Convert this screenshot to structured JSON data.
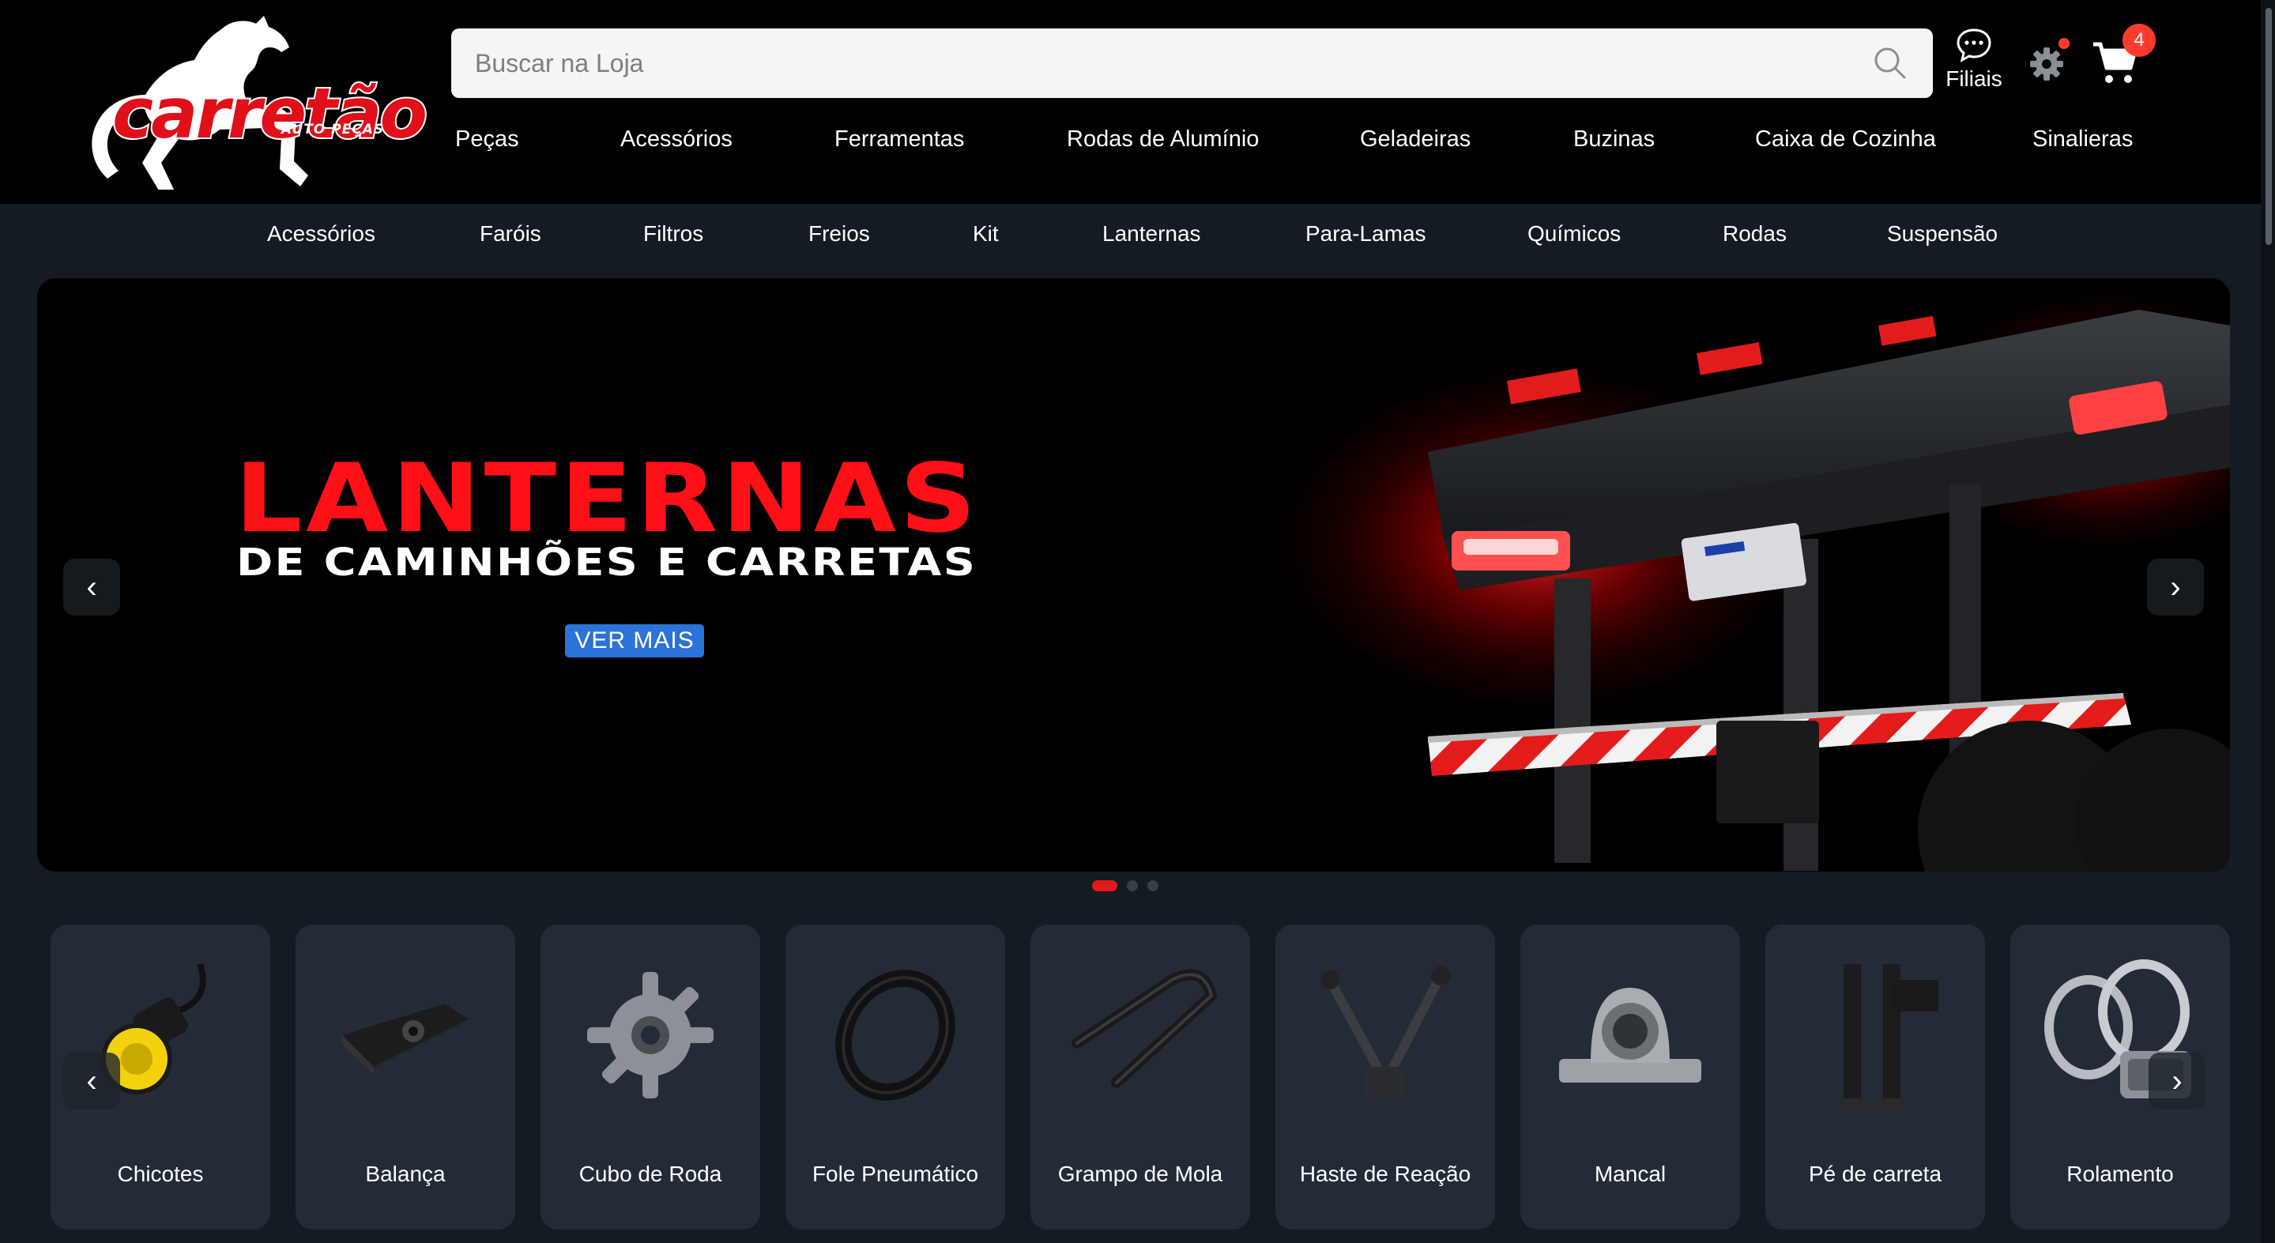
{
  "brand": {
    "name": "carretão",
    "tagline": "AUTO PEÇAS"
  },
  "search": {
    "placeholder": "Buscar na Loja",
    "value": ""
  },
  "header_actions": {
    "filiais_label": "Filiais",
    "cart_count": "4"
  },
  "main_nav": [
    "Peças",
    "Acessórios",
    "Ferramentas",
    "Rodas de Alumínio",
    "Geladeiras",
    "Buzinas",
    "Caixa de Cozinha",
    "Sinalieras"
  ],
  "sub_nav": [
    "Acessórios",
    "Faróis",
    "Filtros",
    "Freios",
    "Kit",
    "Lanternas",
    "Para-Lamas",
    "Químicos",
    "Rodas",
    "Suspensão"
  ],
  "hero": {
    "title": "LANTERNAS",
    "subtitle": "DE CAMINHÕES E CARRETAS",
    "cta": "VER MAIS",
    "prev_arrow": "‹",
    "next_arrow": "›",
    "slides_total": 3,
    "active_slide": 1
  },
  "categories": [
    {
      "label": "Chicotes",
      "icon": "wire-harness-icon"
    },
    {
      "label": "Balança",
      "icon": "balance-icon"
    },
    {
      "label": "Cubo de Roda",
      "icon": "wheel-hub-icon"
    },
    {
      "label": "Fole Pneumático",
      "icon": "air-bellow-icon"
    },
    {
      "label": "Grampo de Mola",
      "icon": "u-bolt-icon"
    },
    {
      "label": "Haste de Reação",
      "icon": "reaction-rod-icon"
    },
    {
      "label": "Mancal",
      "icon": "bearing-block-icon"
    },
    {
      "label": "Pé de carreta",
      "icon": "landing-gear-icon"
    },
    {
      "label": "Rolamento",
      "icon": "roller-bearing-icon"
    }
  ],
  "category_arrows": {
    "prev": "‹",
    "next": "›"
  },
  "colors": {
    "header_bg": "#000000",
    "page_bg": "#151b22",
    "card_bg": "#232c36",
    "brand_red": "#e10f19",
    "cta_blue": "#2b73d9",
    "badge_red": "#ff3b2f"
  }
}
